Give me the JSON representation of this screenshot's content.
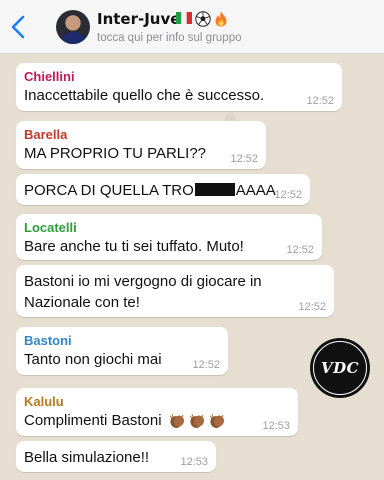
{
  "header": {
    "group_name": "Inter-Juve",
    "group_emojis": [
      "flag-italy-icon",
      "soccer-ball-icon",
      "fire-icon"
    ],
    "subtitle": "tocca qui per info sul gruppo"
  },
  "colors": {
    "chiellini": "#c2185b",
    "barella": "#c0392b",
    "locatelli": "#2e9e3a",
    "bastoni": "#2f86c9",
    "kalulu": "#b77a1e",
    "back": "#1a7ef2"
  },
  "messages": [
    {
      "sender": "Chiellini",
      "lines": [
        "Inaccettabile quello che è successo."
      ],
      "time": "12:52"
    },
    {
      "sender": "Barella",
      "lines": [
        "MA PROPRIO TU PARLI??"
      ],
      "time": "12:52"
    },
    {
      "sender": "",
      "text_before": "PORCA DI QUELLA TRO",
      "text_after": "AAAA",
      "time": "12:52"
    },
    {
      "sender": "Locatelli",
      "lines": [
        "Bare anche tu ti sei tuffato. Muto!"
      ],
      "time": "12:52"
    },
    {
      "sender": "",
      "lines": [
        "Bastoni io mi vergogno di giocare in",
        "Nazionale con te!"
      ],
      "time": "12:52"
    },
    {
      "sender": "Bastoni",
      "lines": [
        "Tanto non giochi mai"
      ],
      "time": "12:52"
    },
    {
      "sender": "Kalulu",
      "lines": [
        "Complimenti Bastoni"
      ],
      "emoji": "clapping-hands-icon",
      "emoji_count": 3,
      "time": "12:53"
    },
    {
      "sender": "",
      "lines": [
        "Bella simulazione!!"
      ],
      "time": "12:53"
    }
  ],
  "watermark": {
    "text": "VDC"
  }
}
